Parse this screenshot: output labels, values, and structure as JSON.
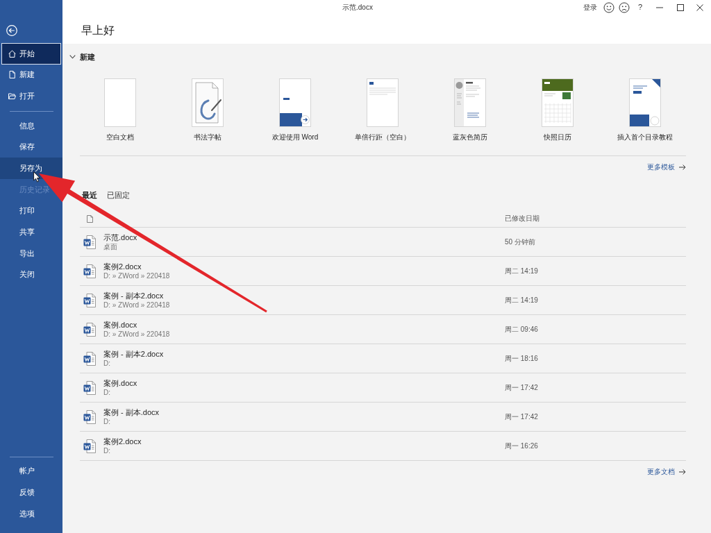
{
  "window": {
    "title": "示范.docx",
    "sign_in": "登录",
    "help": "?"
  },
  "sidebar": {
    "primary": [
      {
        "label": "开始",
        "selected": true,
        "highlighted": false,
        "disabled": false
      },
      {
        "label": "新建",
        "selected": false,
        "highlighted": false,
        "disabled": false
      },
      {
        "label": "打开",
        "selected": false,
        "highlighted": false,
        "disabled": false
      }
    ],
    "file_actions": [
      {
        "label": "信息",
        "selected": false,
        "highlighted": false,
        "disabled": false
      },
      {
        "label": "保存",
        "selected": false,
        "highlighted": false,
        "disabled": false
      },
      {
        "label": "另存为",
        "selected": false,
        "highlighted": true,
        "disabled": false
      },
      {
        "label": "历史记录",
        "selected": false,
        "highlighted": false,
        "disabled": true
      },
      {
        "label": "打印",
        "selected": false,
        "highlighted": false,
        "disabled": false
      },
      {
        "label": "共享",
        "selected": false,
        "highlighted": false,
        "disabled": false
      },
      {
        "label": "导出",
        "selected": false,
        "highlighted": false,
        "disabled": false
      },
      {
        "label": "关闭",
        "selected": false,
        "highlighted": false,
        "disabled": false
      }
    ],
    "footer": [
      {
        "label": "帐户",
        "selected": false,
        "highlighted": false,
        "disabled": false
      },
      {
        "label": "反馈",
        "selected": false,
        "highlighted": false,
        "disabled": false
      },
      {
        "label": "选项",
        "selected": false,
        "highlighted": false,
        "disabled": false
      }
    ]
  },
  "greeting": "早上好",
  "new_section": {
    "title": "新建",
    "expanded": true,
    "templates": [
      {
        "label": "空白文档",
        "kind": "blank"
      },
      {
        "label": "书法字帖",
        "kind": "calligraphy"
      },
      {
        "label": "欢迎使用 Word",
        "kind": "welcome"
      },
      {
        "label": "单倍行距（空白）",
        "kind": "single_spacing"
      },
      {
        "label": "蓝灰色简历",
        "kind": "resume"
      },
      {
        "label": "快照日历",
        "kind": "calendar"
      },
      {
        "label": "插入首个目录教程",
        "kind": "toc"
      }
    ],
    "more_link": "更多模板"
  },
  "recent": {
    "tabs": [
      {
        "label": "最近",
        "selected": true
      },
      {
        "label": "已固定",
        "selected": false
      }
    ],
    "date_column": "已修改日期",
    "rows": [
      {
        "name": "示范.docx",
        "location": "桌面",
        "modified": "50 分钟前"
      },
      {
        "name": "案例2.docx",
        "location": "D: » ZWord » 220418",
        "modified": "周二 14:19"
      },
      {
        "name": "案例 - 副本2.docx",
        "location": "D: » ZWord » 220418",
        "modified": "周二 14:19"
      },
      {
        "name": "案例.docx",
        "location": "D: » ZWord » 220418",
        "modified": "周二 09:46"
      },
      {
        "name": "案例 - 副本2.docx",
        "location": "D:",
        "modified": "周一 18:16"
      },
      {
        "name": "案例.docx",
        "location": "D:",
        "modified": "周一 17:42"
      },
      {
        "name": "案例 - 副本.docx",
        "location": "D:",
        "modified": "周一 17:42"
      },
      {
        "name": "案例2.docx",
        "location": "D:",
        "modified": "周一 16:26"
      }
    ],
    "more_link": "更多文档"
  }
}
